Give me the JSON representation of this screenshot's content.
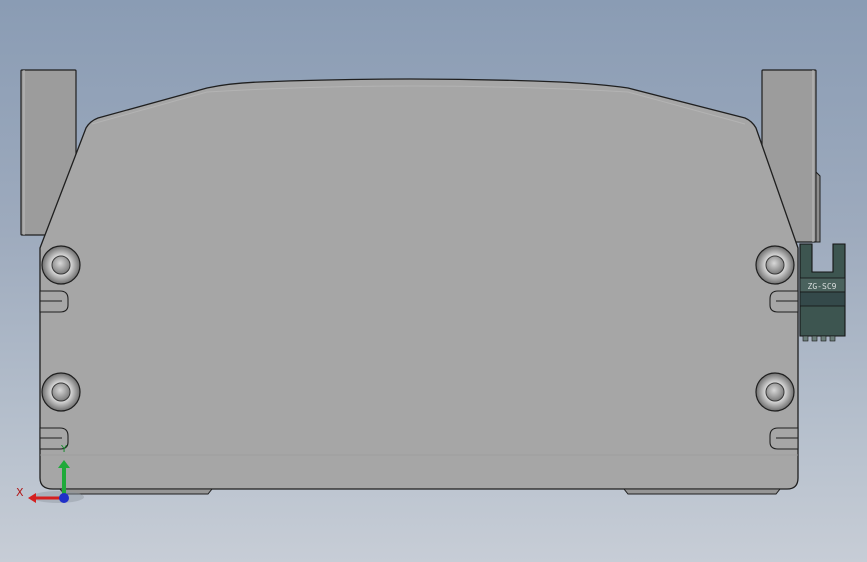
{
  "viewport": {
    "colors": {
      "background_top": "#8a9cb4",
      "background_bottom": "#c7cdd6",
      "part_face": "#a6a6a6",
      "part_edge": "#1f1f1f",
      "side_block": "#9b9b9b",
      "connector": "#3d5550",
      "axis_x": "#d42020",
      "axis_y": "#1faa3a",
      "axis_z": "#2030c8"
    }
  },
  "model": {
    "connector_marking": "ZG-SC9"
  },
  "triad": {
    "x_label": "X",
    "y_label": "Y"
  }
}
